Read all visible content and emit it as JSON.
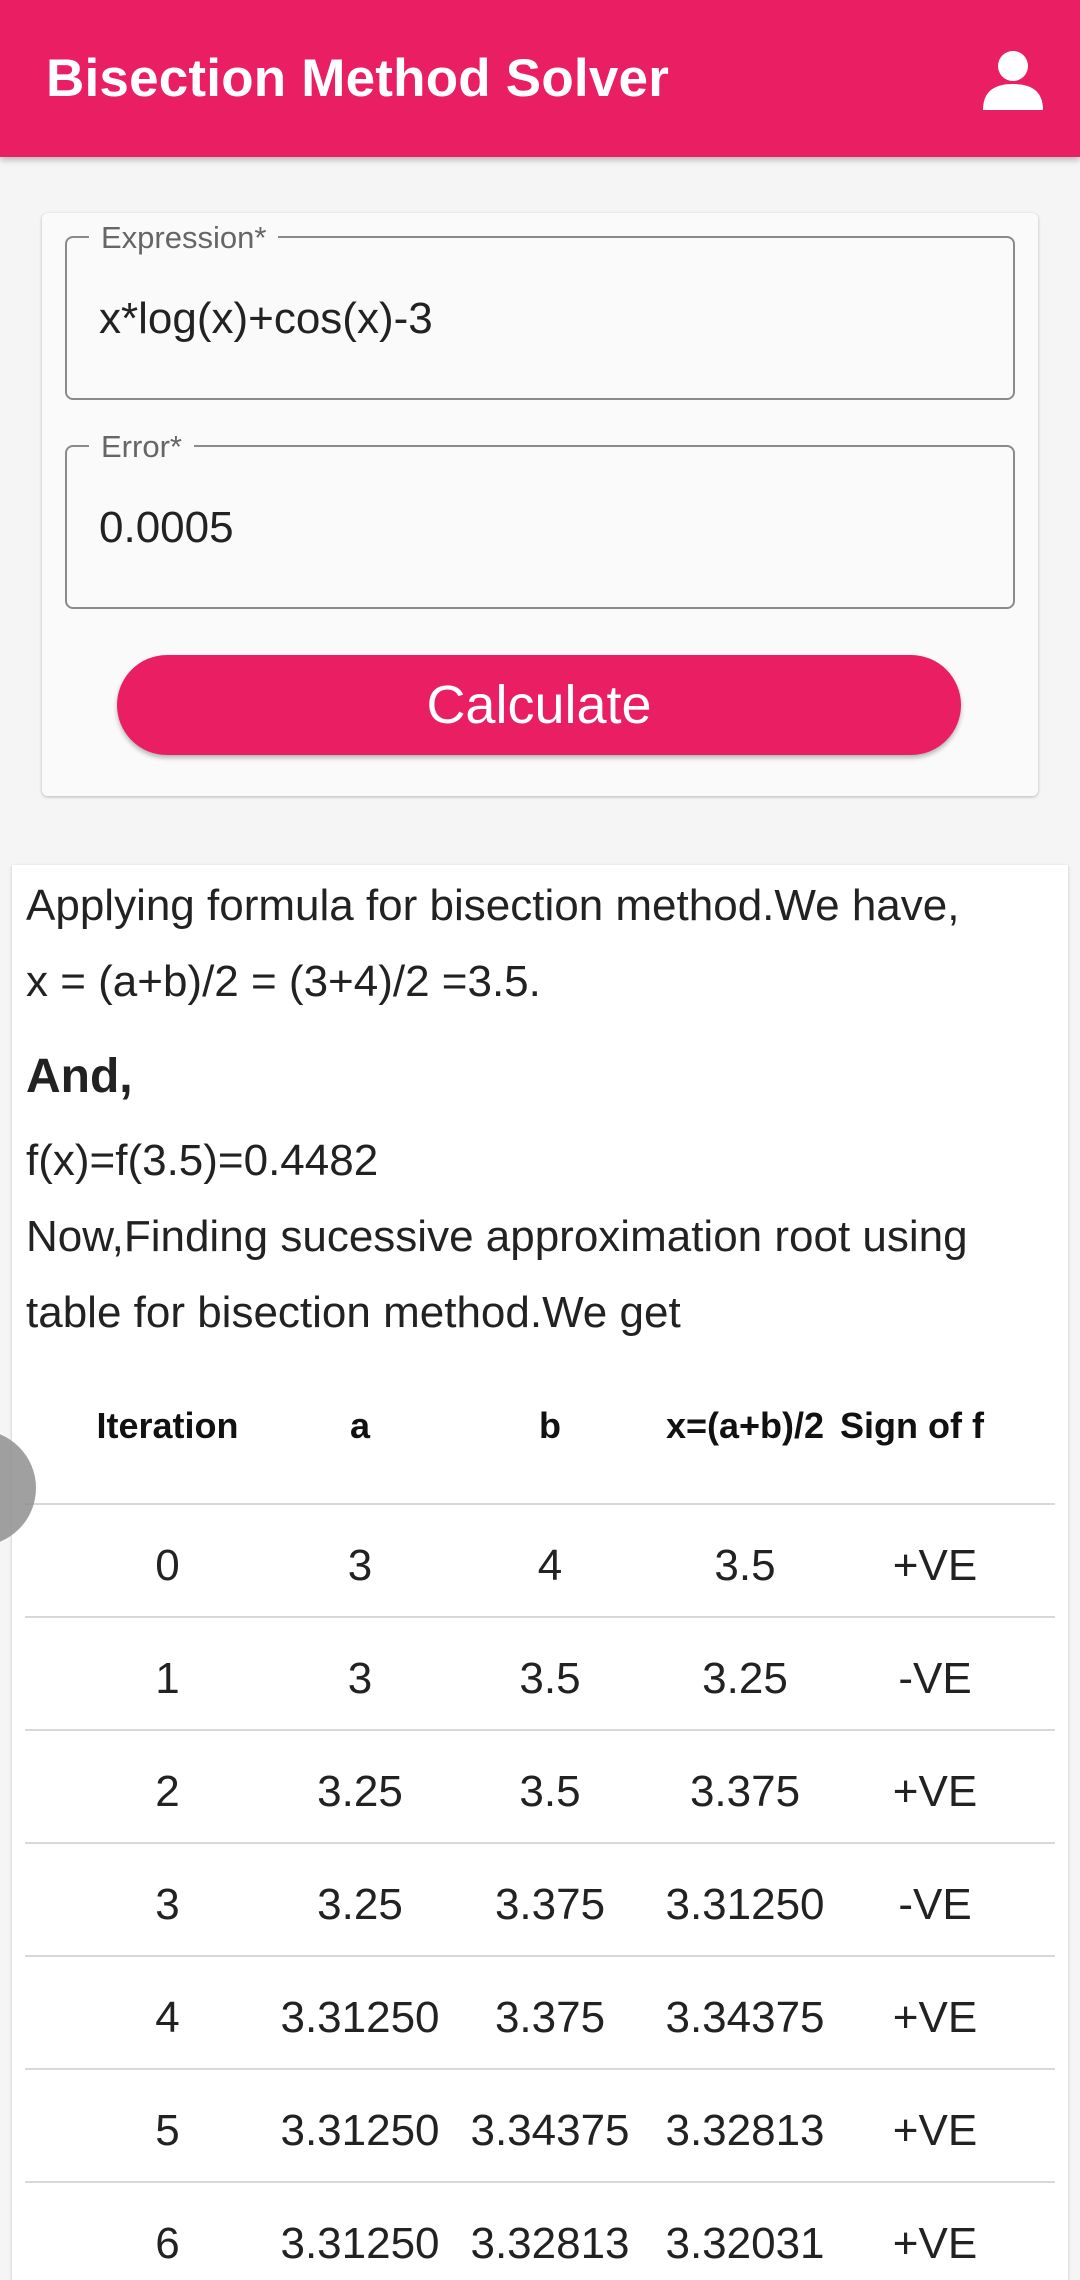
{
  "app_bar": {
    "title": "Bisection Method Solver",
    "account_icon": "account-circle-icon",
    "background_color": "#ea1e63"
  },
  "form": {
    "expression": {
      "label": "Expression*",
      "value": "x*log(x)+cos(x)-3"
    },
    "error": {
      "label": "Error*",
      "value": "0.0005"
    },
    "calculate_label": "Calculate"
  },
  "result": {
    "line1": "Applying formula for bisection method.We have,",
    "line2": "x = (a+b)/2 = (3+4)/2 =3.5.",
    "and_heading": "And,",
    "line3": "f(x)=f(3.5)=0.4482",
    "line4": "Now,Finding sucessive approximation root using",
    "line5": "table for bisection method.We get",
    "table": {
      "headers": [
        "Iteration",
        "a",
        "b",
        "x=(a+b)/2",
        "Sign of f"
      ],
      "rows": [
        [
          "0",
          "3",
          "4",
          "3.5",
          "+VE"
        ],
        [
          "1",
          "3",
          "3.5",
          "3.25",
          "-VE"
        ],
        [
          "2",
          "3.25",
          "3.5",
          "3.375",
          "+VE"
        ],
        [
          "3",
          "3.25",
          "3.375",
          "3.31250",
          "-VE"
        ],
        [
          "4",
          "3.31250",
          "3.375",
          "3.34375",
          "+VE"
        ],
        [
          "5",
          "3.31250",
          "3.34375",
          "3.32813",
          "+VE"
        ],
        [
          "6",
          "3.31250",
          "3.32813",
          "3.32031",
          "+VE"
        ]
      ]
    }
  }
}
